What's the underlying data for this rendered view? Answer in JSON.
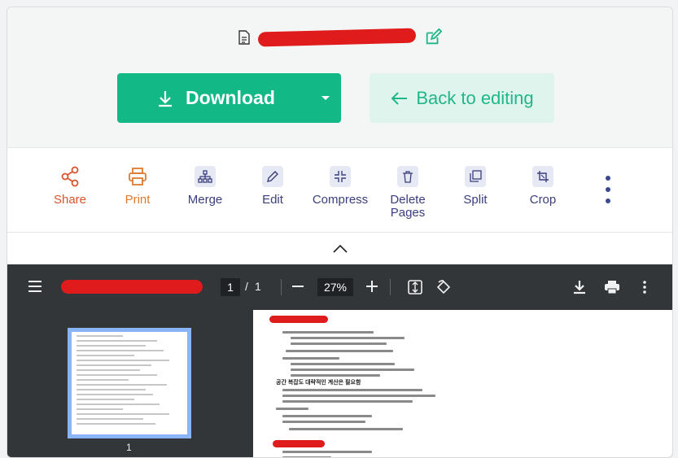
{
  "app": {
    "accent": "#12b886",
    "tool_color": "#3a3e7c"
  },
  "header": {
    "download_label": "Download",
    "back_label": "Back to editing"
  },
  "tools": [
    {
      "label": "Share",
      "icon": "share-icon"
    },
    {
      "label": "Print",
      "icon": "printer-icon"
    },
    {
      "label": "Merge",
      "icon": "merge-icon"
    },
    {
      "label": "Edit",
      "icon": "pencil-icon"
    },
    {
      "label": "Compress",
      "icon": "compress-icon"
    },
    {
      "label": "Delete Pages",
      "icon": "trash-icon"
    },
    {
      "label": "Split",
      "icon": "split-icon"
    },
    {
      "label": "Crop",
      "icon": "crop-icon"
    }
  ],
  "viewer": {
    "current_page": "1",
    "separator": "/",
    "total_pages": "1",
    "zoom": "27%",
    "thumbnail_label": "1",
    "section_heading": "공간 복잡도 대략적인 계산은 필요함"
  }
}
